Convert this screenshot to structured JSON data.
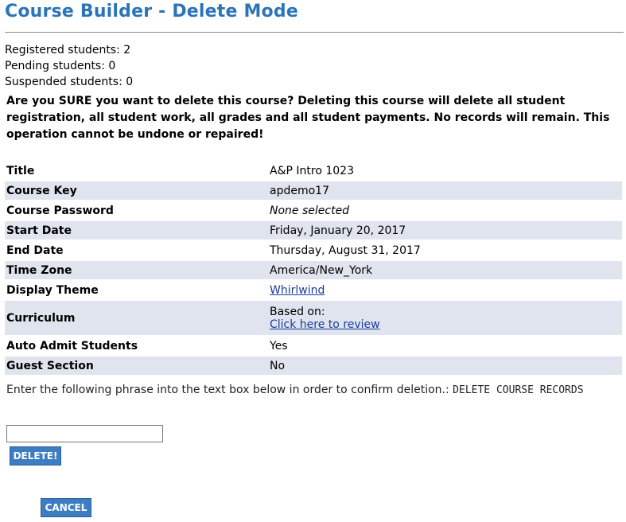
{
  "page_title": "Course Builder - Delete Mode",
  "counts": {
    "registered": "Registered students: 2",
    "pending": "Pending students: 0",
    "suspended": "Suspended students: 0"
  },
  "warning": "Are you SURE you want to delete this course? Deleting this course will delete all student registration, all student work, all grades and all student payments. No records will remain. This operation cannot be undone or repaired!",
  "details": {
    "title": {
      "label": "Title",
      "value": "A&P Intro 1023"
    },
    "course_key": {
      "label": "Course Key",
      "value": "apdemo17"
    },
    "course_password": {
      "label": "Course Password",
      "value": "None selected"
    },
    "start_date": {
      "label": "Start Date",
      "value": "Friday, January 20, 2017"
    },
    "end_date": {
      "label": "End Date",
      "value": "Thursday, August 31, 2017"
    },
    "time_zone": {
      "label": "Time Zone",
      "value": "America/New_York"
    },
    "display_theme": {
      "label": "Display Theme",
      "value": "Whirlwind"
    },
    "curriculum": {
      "label": "Curriculum",
      "based_on": "Based on:",
      "link": "Click here to review"
    },
    "auto_admit": {
      "label": "Auto Admit Students",
      "value": "Yes"
    },
    "guest_section": {
      "label": "Guest Section",
      "value": "No"
    }
  },
  "confirm": {
    "instruction": "Enter the following phrase into the text box below in order to confirm deletion.:",
    "phrase": "DELETE COURSE RECORDS",
    "input_value": ""
  },
  "buttons": {
    "delete": "DELETE!",
    "cancel": "CANCEL"
  },
  "colors": {
    "title": "#2b74b8",
    "row_shade": "#dfe4ee",
    "button": "#3d7ec3",
    "link": "#1a3c9e"
  }
}
